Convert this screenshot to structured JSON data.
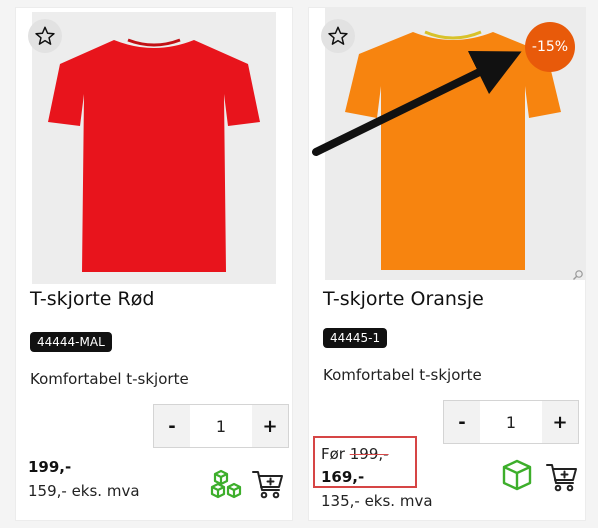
{
  "products": [
    {
      "title": "T-skjorte Rød",
      "sku": "44444-MAL",
      "description": "Komfortabel t-skjorte",
      "quantity": "1",
      "minus_label": "-",
      "plus_label": "+",
      "price": "199,-",
      "price_ex_vat": "159,- eks. mva",
      "shirt_color": "#e8141c",
      "stock_icon": "boxes-icon",
      "cart_icon": "add-to-cart-icon"
    },
    {
      "title": "T-skjorte Oransje",
      "sku": "44445-1",
      "description": "Komfortabel t-skjorte",
      "quantity": "1",
      "minus_label": "-",
      "plus_label": "+",
      "before_label": "Før",
      "old_price": "199,-",
      "price": "169,-",
      "price_ex_vat": "135,- eks. mva",
      "discount_badge": "-15%",
      "shirt_color": "#f7840f",
      "badge_color": "#e85a0a",
      "stock_icon": "box-icon",
      "cart_icon": "add-to-cart-icon"
    }
  ]
}
